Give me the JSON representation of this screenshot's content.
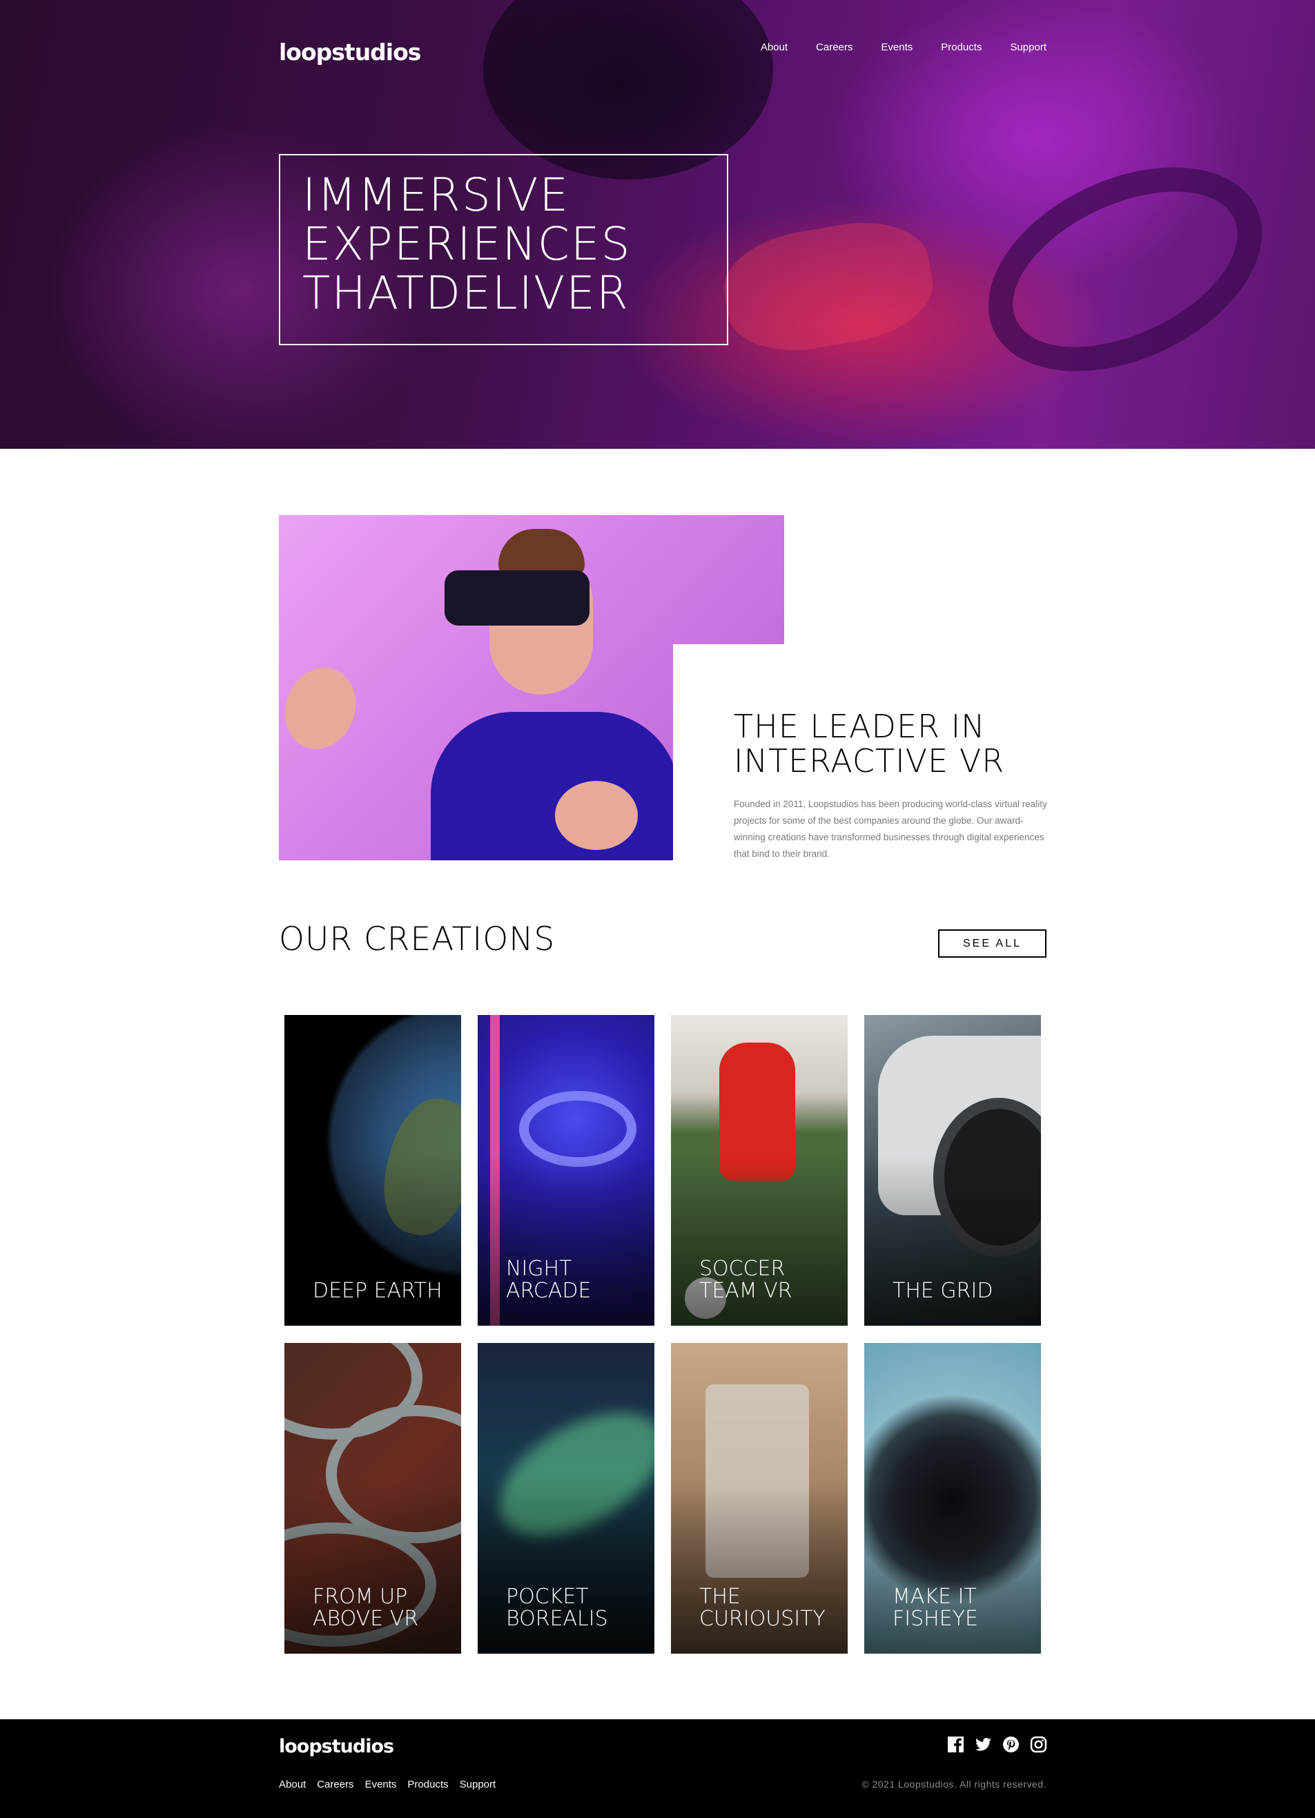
{
  "header": {
    "logo": "loopstudios",
    "nav": [
      "About",
      "Careers",
      "Events",
      "Products",
      "Support"
    ]
  },
  "hero": {
    "title_lines": [
      "IMMERSIVE",
      "EXPERIENCES",
      "THATDELIVER"
    ]
  },
  "about": {
    "title_lines": [
      "THE LEADER IN",
      "INTERACTIVE VR"
    ],
    "text": "Founded in 2011, Loopstudios has been producing world-class virtual reality projects for some of the best companies around the globe. Our award-winning creations have transformed businesses through digital experiences that bind to their brand."
  },
  "creations": {
    "title": "OUR CREATIONS",
    "see_all_label": "SEE ALL",
    "items": [
      {
        "label": "DEEP EARTH"
      },
      {
        "label": "NIGHT ARCADE"
      },
      {
        "label": "SOCCER TEAM VR"
      },
      {
        "label": "THE GRID"
      },
      {
        "label": "FROM UP ABOVE VR"
      },
      {
        "label": "POCKET BOREALIS"
      },
      {
        "label": "THE CURIOUSITY"
      },
      {
        "label": "MAKE IT FISHEYE"
      }
    ]
  },
  "footer": {
    "logo": "loopstudios",
    "nav": [
      "About",
      "Careers",
      "Events",
      "Products",
      "Support"
    ],
    "social_icons": [
      "facebook-icon",
      "twitter-icon",
      "pinterest-icon",
      "instagram-icon"
    ],
    "copyright": "© 2021 Loopstudios. All rights reserved."
  }
}
